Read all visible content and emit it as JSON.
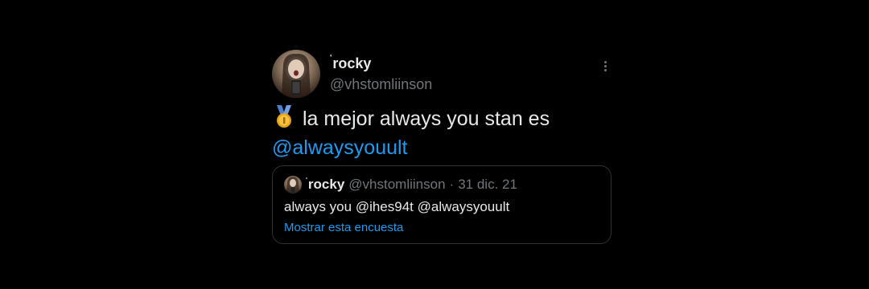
{
  "tweet": {
    "author": {
      "name_mark": "'",
      "display_name": "rocky",
      "handle": "@vhstomliinson"
    },
    "more_icon": "more-vertical-icon",
    "body": {
      "emoji": "1st-place-medal",
      "text": "la mejor always you stan es",
      "mention": "@alwaysyouult"
    },
    "colors": {
      "background": "#000000",
      "text": "#e7e9ea",
      "secondary": "#71767b",
      "link": "#1d9bf0",
      "border": "#2f3336"
    }
  },
  "quote": {
    "name_mark": "'",
    "display_name": "rocky",
    "handle": "@vhstomliinson",
    "separator": "·",
    "date": "31 dic. 21",
    "text": "always you @ihes94t @alwaysyouult",
    "poll_link": "Mostrar esta encuesta"
  }
}
